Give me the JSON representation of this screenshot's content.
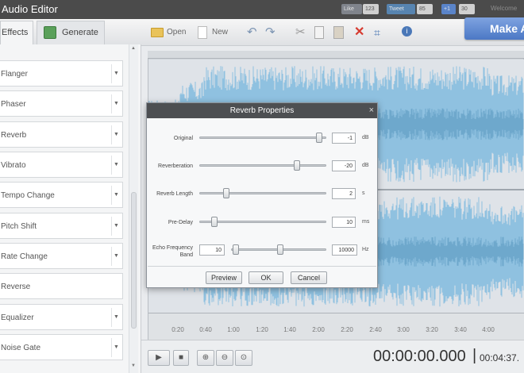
{
  "window": {
    "title": "Audio Editor",
    "welcome": "Welcome"
  },
  "social": {
    "like": "Like",
    "like_count": "123",
    "tweet": "Tweet",
    "tweet_count": "85",
    "plus": "+1",
    "plus_count": "30"
  },
  "tabs": [
    {
      "label": "Effects"
    },
    {
      "label": "Generate"
    }
  ],
  "toolbar": {
    "open_label": "Open",
    "new_label": "New",
    "undo_glyph": "↶",
    "redo_glyph": "↷",
    "cut_glyph": "✂",
    "delete_glyph": "✕",
    "crop_glyph": "⌗",
    "info_glyph": "i",
    "make_label": "Make A"
  },
  "effects": [
    {
      "label": "Flanger"
    },
    {
      "label": "Phaser"
    },
    {
      "label": "Reverb"
    },
    {
      "label": "Vibrato"
    },
    {
      "label": "Tempo Change"
    },
    {
      "label": "Pitch Shift"
    },
    {
      "label": "Rate Change"
    },
    {
      "label": "Reverse"
    },
    {
      "label": "Equalizer"
    },
    {
      "label": "Noise Gate"
    }
  ],
  "timeline": {
    "ticks": [
      "0:20",
      "0:40",
      "1:00",
      "1:20",
      "1:40",
      "2:00",
      "2:20",
      "2:40",
      "3:00",
      "3:20",
      "3:40",
      "4:00"
    ]
  },
  "controls": {
    "play_glyph": "▶",
    "stop_glyph": "■",
    "zoom_in_glyph": "⊕",
    "zoom_out_glyph": "⊖",
    "zoom_fit_glyph": "⊙"
  },
  "time": {
    "current": "00:00:00.000",
    "separator": "|",
    "total": "00:04:37."
  },
  "dialog": {
    "title": "Reverb Properties",
    "close_glyph": "×",
    "rows": [
      {
        "label": "Original",
        "value": "-1",
        "unit": "dB",
        "level": 0.97
      },
      {
        "label": "Reverberation",
        "value": "-20",
        "unit": "dB",
        "level": 0.78
      },
      {
        "label": "Reverb Length",
        "value": "2",
        "unit": "s",
        "level": 0.2
      },
      {
        "label": "Pre-Delay",
        "value": "10",
        "unit": "ms",
        "level": 0.1
      }
    ],
    "echo": {
      "label_line1": "Echo Frequency",
      "label_line2": "Band",
      "low": "10",
      "high": "10000",
      "unit": "Hz",
      "low_level": 0.02,
      "high_level": 0.52
    },
    "buttons": {
      "preview": "Preview",
      "ok": "OK",
      "cancel": "Cancel"
    }
  },
  "colors": {
    "waveform": "#8fc1e0",
    "waveform_dark": "#6ea8cc",
    "title_bar": "#4b4b4b",
    "make_button": "#5b84cf"
  }
}
